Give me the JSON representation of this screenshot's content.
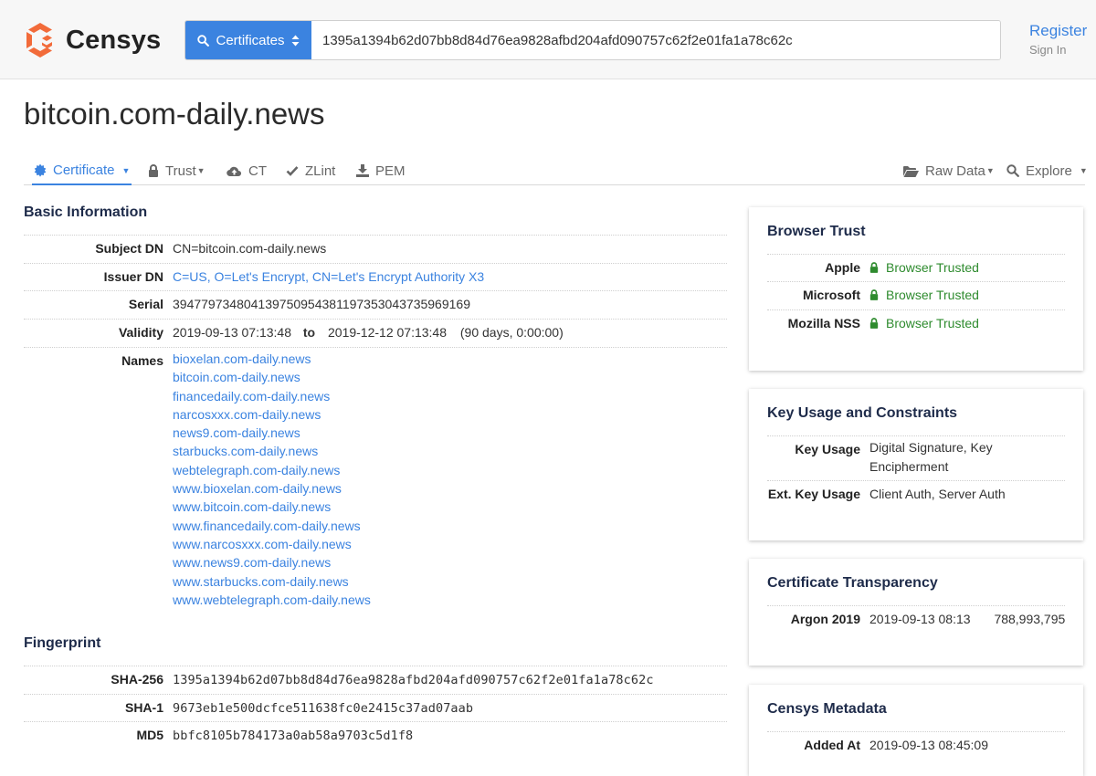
{
  "header": {
    "logo_text": "Censys",
    "search_type": "Certificates",
    "search_value": "1395a1394b62d07bb8d84d76ea9828afbd204afd090757c62f2e01fa1a78c62c",
    "register": "Register",
    "sign_in": "Sign In"
  },
  "page": {
    "title": "bitcoin.com-daily.news"
  },
  "tabs": {
    "certificate": "Certificate",
    "trust": "Trust",
    "ct": "CT",
    "zlint": "ZLint",
    "pem": "PEM",
    "raw_data": "Raw Data",
    "explore": "Explore"
  },
  "basic": {
    "title": "Basic Information",
    "subject_label": "Subject DN",
    "subject_value": "CN=bitcoin.com-daily.news",
    "issuer_label": "Issuer DN",
    "issuer_value": "C=US, O=Let's Encrypt, CN=Let's Encrypt Authority X3",
    "serial_label": "Serial",
    "serial_value": "394779734804139750954381197353043735969169",
    "validity_label": "Validity",
    "validity_from": "2019-09-13 07:13:48",
    "validity_to_word": "to",
    "validity_to": "2019-12-12 07:13:48",
    "validity_duration": "(90 days, 0:00:00)",
    "names_label": "Names",
    "names": [
      "bioxelan.com-daily.news",
      "bitcoin.com-daily.news",
      "financedaily.com-daily.news",
      "narcosxxx.com-daily.news",
      "news9.com-daily.news",
      "starbucks.com-daily.news",
      "webtelegraph.com-daily.news",
      "www.bioxelan.com-daily.news",
      "www.bitcoin.com-daily.news",
      "www.financedaily.com-daily.news",
      "www.narcosxxx.com-daily.news",
      "www.news9.com-daily.news",
      "www.starbucks.com-daily.news",
      "www.webtelegraph.com-daily.news"
    ]
  },
  "fingerprint": {
    "title": "Fingerprint",
    "sha256_label": "SHA-256",
    "sha256_value": "1395a1394b62d07bb8d84d76ea9828afbd204afd090757c62f2e01fa1a78c62c",
    "sha1_label": "SHA-1",
    "sha1_value": "9673eb1e500dcfce511638fc0e2415c37ad07aab",
    "md5_label": "MD5",
    "md5_value": "bbfc8105b784173a0ab58a9703c5d1f8"
  },
  "browser_trust": {
    "title": "Browser Trust",
    "rows": [
      {
        "label": "Apple",
        "value": "Browser Trusted"
      },
      {
        "label": "Microsoft",
        "value": "Browser Trusted"
      },
      {
        "label": "Mozilla NSS",
        "value": "Browser Trusted"
      }
    ]
  },
  "key_usage": {
    "title": "Key Usage and Constraints",
    "key_usage_label": "Key Usage",
    "key_usage_line1": "Digital Signature, Key",
    "key_usage_line2": "Encipherment",
    "ext_label": "Ext. Key Usage",
    "ext_value": "Client Auth, Server Auth"
  },
  "ct": {
    "title": "Certificate Transparency",
    "log_label": "Argon 2019",
    "log_date": "2019-09-13 08:13",
    "log_index": "788,993,795"
  },
  "metadata": {
    "title": "Censys Metadata",
    "added_label": "Added At",
    "added_value": "2019-09-13 08:45:09"
  },
  "colors": {
    "accent": "#3b83e0",
    "logo": "#f26b3a",
    "trusted": "#2e8b2e",
    "heading": "#1e2b4a"
  }
}
